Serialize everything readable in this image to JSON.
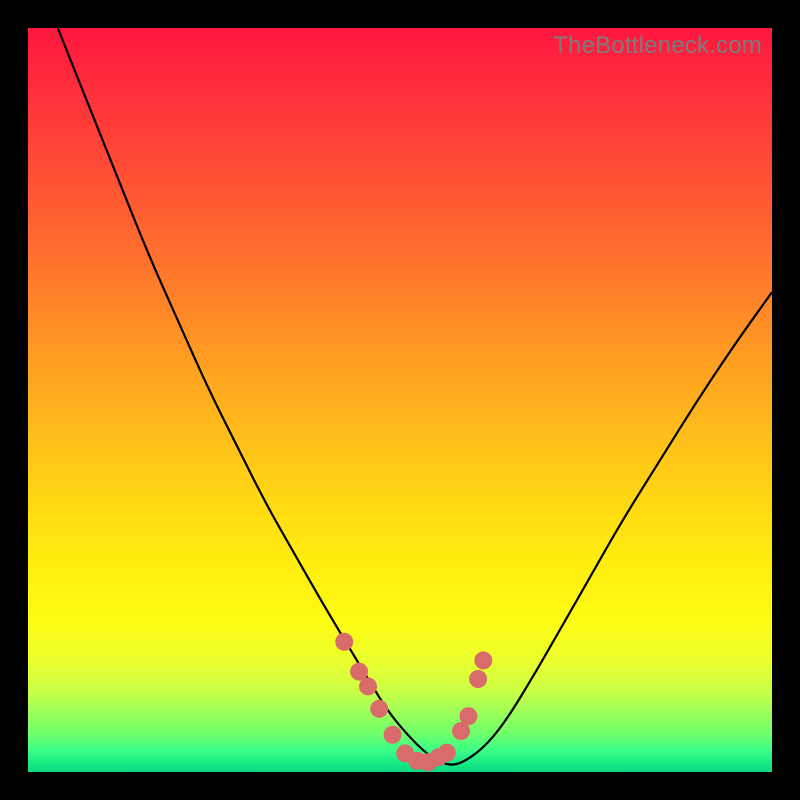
{
  "watermark": "TheBottleneck.com",
  "colors": {
    "marker": "#D96B6A",
    "curve": "#000000",
    "frame": "#000000"
  },
  "chart_data": {
    "type": "line",
    "title": "",
    "xlabel": "",
    "ylabel": "",
    "xlim": [
      0,
      100
    ],
    "ylim": [
      0,
      100
    ],
    "note": "No numeric axes or tick labels are visible; x/y are normalized 0–100 estimates from pixel positions. y is inverted for plotting (0 = top).",
    "series": [
      {
        "name": "curve",
        "type": "line",
        "x": [
          4,
          8,
          12,
          16,
          20,
          24,
          28,
          32,
          36,
          40,
          43,
          46,
          48.5,
          51,
          53.5,
          56,
          58,
          61,
          64,
          68,
          72,
          76,
          80,
          85,
          90,
          95,
          100
        ],
        "y": [
          0,
          10,
          20,
          30,
          39,
          48,
          56,
          64,
          71,
          78,
          83,
          88,
          92,
          95,
          97.5,
          99,
          99,
          97,
          93.5,
          87,
          80,
          73,
          66,
          58,
          50,
          42.5,
          35.5
        ]
      },
      {
        "name": "markers",
        "type": "scatter",
        "note": "Clustered points near curve minimum, salmon colored",
        "x": [
          42.5,
          44.5,
          45.7,
          47.2,
          49.0,
          50.7,
          52.3,
          53.8,
          55.2,
          56.3,
          58.2,
          59.2,
          60.5,
          61.2
        ],
        "y": [
          82.5,
          86.5,
          88.5,
          91.5,
          95.0,
          97.5,
          98.5,
          98.7,
          98.0,
          97.4,
          94.5,
          92.5,
          87.5,
          85.0
        ]
      }
    ]
  }
}
